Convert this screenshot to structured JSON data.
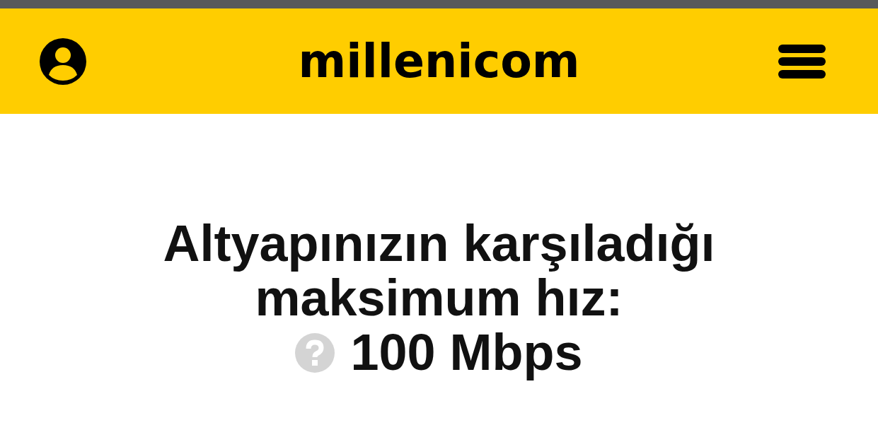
{
  "header": {
    "logo": "millenicom"
  },
  "speed_info": {
    "title": "Altyapınızın karşıladığı maksimum hız:",
    "value": "100 Mbps"
  }
}
